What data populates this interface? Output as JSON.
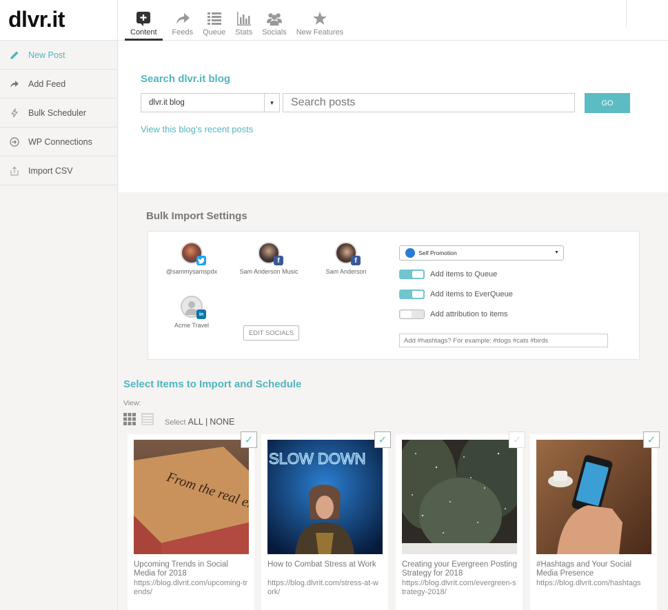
{
  "app": {
    "logo": "dlvr.it"
  },
  "nav": [
    {
      "label": "Content",
      "icon": "plus-square-icon",
      "active": true
    },
    {
      "label": "Feeds",
      "icon": "share-arrow-icon"
    },
    {
      "label": "Queue",
      "icon": "list-icon"
    },
    {
      "label": "Stats",
      "icon": "bar-chart-icon"
    },
    {
      "label": "Socials",
      "icon": "users-icon"
    },
    {
      "label": "New Features",
      "icon": "star-icon"
    }
  ],
  "sidebar": [
    {
      "label": "New Post",
      "icon": "pencil-icon",
      "active": true
    },
    {
      "label": "Add Feed",
      "icon": "share-arrow-icon"
    },
    {
      "label": "Bulk Scheduler",
      "icon": "lightning-icon"
    },
    {
      "label": "WP Connections",
      "icon": "sign-in-icon"
    },
    {
      "label": "Import CSV",
      "icon": "upload-icon"
    }
  ],
  "search": {
    "title": "Search dlvr.it blog",
    "blog_select": "dlvr.it blog",
    "placeholder": "Search posts",
    "go_label": "GO",
    "recent_link": "View this blog's recent posts"
  },
  "bulk": {
    "title": "Bulk Import Settings",
    "socials": [
      {
        "name": "@sammysamspdx",
        "network": "twitter"
      },
      {
        "name": "Sam Anderson Music",
        "network": "facebook"
      },
      {
        "name": "Sam Anderson",
        "network": "facebook"
      },
      {
        "name": "Acme Travel",
        "network": "linkedin"
      }
    ],
    "edit_socials": "EDIT SOCIALS",
    "promotion": "Self Promotion",
    "toggles": [
      {
        "label": "Add items to Queue",
        "on": true
      },
      {
        "label": "Add items to EverQueue",
        "on": true
      },
      {
        "label": "Add attribution to items",
        "on": false
      }
    ],
    "hashtags_placeholder": "Add #hashtags? For example: #dogs #cats #birds"
  },
  "select": {
    "title": "Select Items to Import and Schedule",
    "view_label": "View:",
    "select_label": "Select",
    "all_label": "ALL",
    "separator": "|",
    "none_label": "NONE"
  },
  "items": [
    {
      "title": "Upcoming Trends in Social Media for 2018",
      "url": "https://blog.dlvrit.com/upcoming-trends/",
      "checked": true,
      "image_text": "From the real experts"
    },
    {
      "title": "How to Combat Stress at Work",
      "url": "https://blog.dlvrit.com/stress-at-work/",
      "checked": true,
      "image_text": "SLOW DOWN"
    },
    {
      "title": "Creating your Evergreen Posting Strategy for 2018",
      "url": "https://blog.dlvrit.com/evergreen-strategy-2018/",
      "checked": false
    },
    {
      "title": "#Hashtags and Your Social Media Presence",
      "url": "https://blog.dlvrit.com/hashtags",
      "checked": true
    }
  ],
  "colors": {
    "accent": "#4fb5bf",
    "button": "#5bbcc3",
    "twitter": "#1da1f2",
    "facebook": "#3b5998",
    "linkedin": "#0e76a8"
  }
}
